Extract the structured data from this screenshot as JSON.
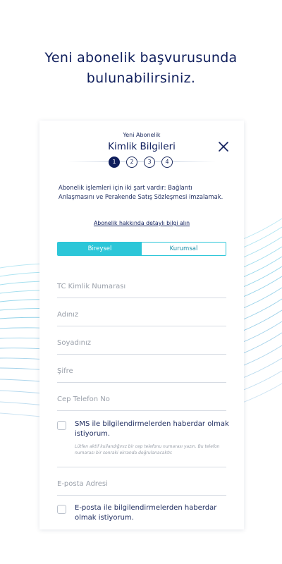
{
  "headline": {
    "line1": "Yeni abonelik başvurusunda",
    "line2": "bulunabilirsiniz."
  },
  "colors": {
    "navy": "#0f1e5c",
    "accent": "#2cc6d8",
    "placeholder": "#9aa0aa"
  },
  "form": {
    "kicker": "Yeni Abonelik",
    "title": "Kimlik Bilgileri",
    "close_icon": "close-icon",
    "steps": [
      "1",
      "2",
      "3",
      "4"
    ],
    "active_step": "1",
    "info_text": "Abonelik işlemleri için iki şart vardır: Bağlantı Anlaşmasını ve Perakende Satış Sözleşmesi imzalamak.",
    "info_link": "Abonelik hakkında detaylı bilgi alın",
    "tabs": [
      "Bireysel",
      "Kurumsal"
    ],
    "active_tab": "Bireysel",
    "fields": {
      "tc": {
        "placeholder": "TC Kimlik Numarası",
        "value": ""
      },
      "name": {
        "placeholder": "Adınız",
        "value": ""
      },
      "surname": {
        "placeholder": "Soyadınız",
        "value": ""
      },
      "password": {
        "placeholder": "Şifre",
        "value": ""
      },
      "phone": {
        "placeholder": "Cep Telefon No",
        "value": ""
      },
      "email": {
        "placeholder": "E-posta Adresi",
        "value": ""
      }
    },
    "sms_consent": "SMS ile bilgilendirmelerden haberdar olmak istiyorum.",
    "sms_note": "Lütfen aktif kullandığınız bir cep telefonu numarası yazın. Bu telefon numarası bir sonraki ekranda doğrulanacaktır.",
    "email_consent": "E-posta ile bilgilendirmelerden haberdar olmak istiyorum."
  }
}
